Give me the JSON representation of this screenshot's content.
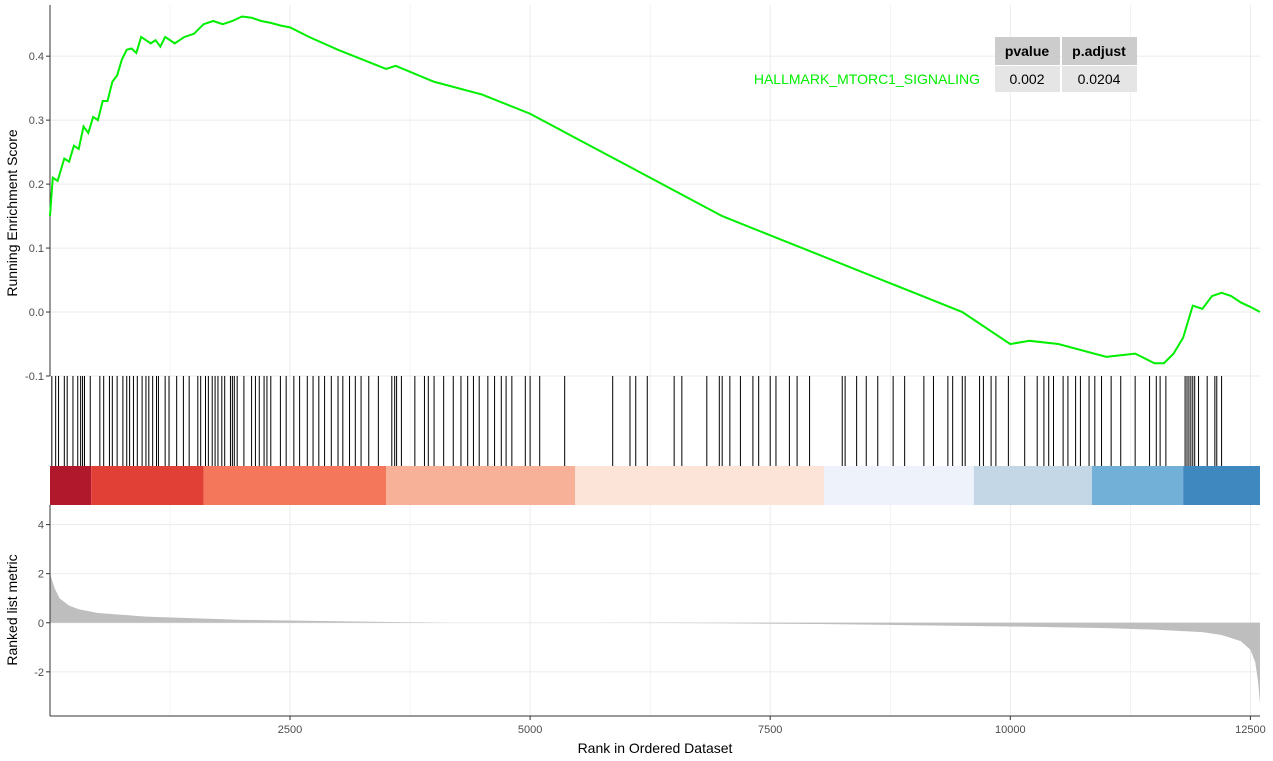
{
  "chart_data": {
    "type": "line",
    "title": "",
    "gene_set": "HALLMARK_MTORC1_SIGNALING",
    "xlabel": "Rank in Ordered Dataset",
    "xlim": [
      1,
      12600
    ],
    "x_ticks": [
      2500,
      5000,
      7500,
      10000,
      12500
    ],
    "x_tick_labels": [
      "2500",
      "5000",
      "7500",
      "10000",
      "12500"
    ],
    "grid": true,
    "colors": {
      "line": "#00ee00",
      "ticks": "#000000",
      "metric_fill": "#bebebe",
      "grid": "#ebebeb"
    },
    "running_es": {
      "ylabel": "Running Enrichment Score",
      "ylim": [
        -0.1,
        0.48
      ],
      "y_ticks": [
        -0.1,
        0.0,
        0.1,
        0.2,
        0.3,
        0.4
      ],
      "y_tick_labels": [
        "-0.1",
        "0.0",
        "0.1",
        "0.2",
        "0.3",
        "0.4"
      ],
      "x": [
        1,
        30,
        80,
        150,
        200,
        250,
        300,
        350,
        400,
        450,
        500,
        550,
        600,
        650,
        700,
        750,
        800,
        850,
        900,
        950,
        1000,
        1050,
        1100,
        1150,
        1200,
        1300,
        1400,
        1500,
        1600,
        1700,
        1800,
        1900,
        2000,
        2100,
        2200,
        2300,
        2400,
        2500,
        2700,
        3000,
        3500,
        3600,
        4000,
        4500,
        5000,
        5500,
        6000,
        6500,
        7000,
        7500,
        8000,
        8500,
        9000,
        9500,
        10000,
        10200,
        10500,
        11000,
        11300,
        11500,
        11600,
        11700,
        11800,
        11900,
        12000,
        12100,
        12200,
        12300,
        12400,
        12500,
        12600
      ],
      "y": [
        0.15,
        0.21,
        0.205,
        0.24,
        0.235,
        0.26,
        0.255,
        0.29,
        0.28,
        0.305,
        0.3,
        0.33,
        0.33,
        0.36,
        0.37,
        0.395,
        0.41,
        0.412,
        0.405,
        0.43,
        0.425,
        0.42,
        0.425,
        0.415,
        0.43,
        0.42,
        0.43,
        0.435,
        0.45,
        0.455,
        0.45,
        0.455,
        0.462,
        0.46,
        0.455,
        0.452,
        0.448,
        0.445,
        0.43,
        0.41,
        0.38,
        0.385,
        0.36,
        0.34,
        0.31,
        0.27,
        0.23,
        0.19,
        0.15,
        0.12,
        0.09,
        0.06,
        0.03,
        0.0,
        -0.05,
        -0.045,
        -0.05,
        -0.07,
        -0.065,
        -0.08,
        -0.08,
        -0.065,
        -0.04,
        0.01,
        0.005,
        0.025,
        0.03,
        0.025,
        0.015,
        0.008,
        0.0
      ]
    },
    "hit_positions": [
      20,
      60,
      90,
      150,
      180,
      240,
      290,
      320,
      340,
      360,
      420,
      520,
      560,
      620,
      650,
      700,
      760,
      800,
      830,
      870,
      910,
      960,
      1000,
      1030,
      1070,
      1110,
      1130,
      1200,
      1240,
      1320,
      1390,
      1450,
      1540,
      1570,
      1620,
      1650,
      1690,
      1720,
      1750,
      1790,
      1820,
      1880,
      1900,
      1920,
      1950,
      2020,
      2100,
      2140,
      2180,
      2230,
      2260,
      2300,
      2400,
      2460,
      2540,
      2600,
      2680,
      2740,
      2800,
      2860,
      2930,
      3000,
      3050,
      3120,
      3180,
      3240,
      3320,
      3420,
      3560,
      3590,
      3610,
      3660,
      3800,
      3900,
      3940,
      4000,
      4100,
      4200,
      4280,
      4350,
      4410,
      4470,
      4560,
      4630,
      4700,
      4750,
      4810,
      4950,
      5000,
      5100,
      5360,
      5860,
      6040,
      6100,
      6220,
      6500,
      6580,
      6840,
      6970,
      7000,
      7080,
      7190,
      7320,
      7380,
      7500,
      7560,
      7700,
      7780,
      7910,
      8250,
      8280,
      8400,
      8500,
      8620,
      8780,
      8900,
      9100,
      9200,
      9350,
      9400,
      9500,
      9530,
      9680,
      9720,
      9800,
      9850,
      9980,
      10150,
      10280,
      10350,
      10400,
      10450,
      10550,
      10600,
      10680,
      10730,
      10820,
      10880,
      10950,
      11050,
      11150,
      11300,
      11450,
      11520,
      11560,
      11620,
      11820,
      11840,
      11860,
      11880,
      11900,
      11920,
      11960,
      12050,
      12130,
      12150,
      12200
    ],
    "color_bands": [
      {
        "from": 0,
        "to": 430,
        "color": "#b2182b"
      },
      {
        "from": 430,
        "to": 1600,
        "color": "#e04035"
      },
      {
        "from": 1600,
        "to": 3500,
        "color": "#f4775c"
      },
      {
        "from": 3500,
        "to": 5470,
        "color": "#f7b198"
      },
      {
        "from": 5470,
        "to": 8060,
        "color": "#fde4d9"
      },
      {
        "from": 8060,
        "to": 9620,
        "color": "#eef2fb"
      },
      {
        "from": 9620,
        "to": 10850,
        "color": "#c3d7e6"
      },
      {
        "from": 10850,
        "to": 11800,
        "color": "#73b0d8"
      },
      {
        "from": 11800,
        "to": 12600,
        "color": "#3f87bf"
      }
    ],
    "ranked_metric": {
      "ylabel": "Ranked list metric",
      "ylim": [
        -3.8,
        4.8
      ],
      "y_ticks": [
        -2,
        0,
        2,
        4
      ],
      "y_tick_labels": [
        "-2",
        "0",
        "2",
        "4"
      ],
      "x": [
        1,
        50,
        100,
        200,
        300,
        500,
        1000,
        2000,
        3000,
        4150,
        5700,
        7000,
        8000,
        9000,
        10000,
        11000,
        11500,
        12000,
        12200,
        12400,
        12500,
        12550,
        12580,
        12600
      ],
      "y": [
        2.0,
        1.4,
        1.0,
        0.7,
        0.55,
        0.4,
        0.25,
        0.12,
        0.06,
        0.0,
        0.0,
        -0.02,
        -0.05,
        -0.1,
        -0.15,
        -0.22,
        -0.28,
        -0.38,
        -0.5,
        -0.75,
        -1.1,
        -1.6,
        -2.4,
        -3.3
      ]
    },
    "pvalue_table": {
      "columns": [
        "pvalue",
        "p.adjust"
      ],
      "row_label": "HALLMARK_MTORC1_SIGNALING",
      "values": [
        "0.002",
        "0.0204"
      ]
    }
  }
}
